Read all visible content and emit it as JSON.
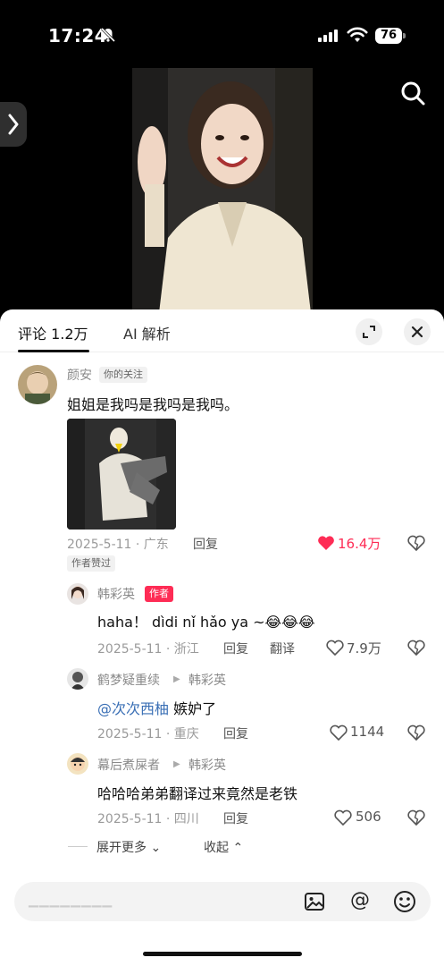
{
  "status_bar": {
    "time": "17:24",
    "battery": "76"
  },
  "tabs": {
    "comments": "评论 1.2万",
    "ai": "AI 解析"
  },
  "comments": [
    {
      "username": "颜安",
      "badge": "你的关注",
      "text": "姐姐是我吗是我吗是我吗。",
      "date_location": "2025-5-11 · 广东",
      "reply": "回复",
      "likes": "16.4万",
      "liked": true,
      "author_badge": "作者赞过"
    }
  ],
  "replies": [
    {
      "username": "韩彩英",
      "badge": "作者",
      "text": "haha！ dìdi nǐ hǎo ya ~",
      "date_location": "2025-5-11 · 浙江",
      "reply": "回复",
      "translate": "翻译",
      "likes": "7.9万"
    },
    {
      "username": "鹤梦疑重续",
      "reply_to": "韩彩英",
      "mention": "@次次西柚",
      "text": " 嫉妒了",
      "date_location": "2025-5-11 · 重庆",
      "reply": "回复",
      "likes": "1144"
    },
    {
      "username": "幕后煮屎者",
      "reply_to": "韩彩英",
      "text": "哈哈哈弟弟翻译过来竟然是老铁",
      "date_location": "2025-5-11 · 四川",
      "reply": "回复",
      "likes": "506"
    }
  ],
  "footer": {
    "expand_more": "展开更多",
    "collapse": "收起"
  },
  "colors": {
    "accent": "#fe2c55",
    "mention": "#3a6fb5"
  },
  "icons": [
    "bell-off-icon",
    "signal-icon",
    "wifi-icon",
    "battery-icon",
    "chevron-right-icon",
    "search-icon",
    "expand-icon",
    "close-icon",
    "heart-icon",
    "dislike-icon",
    "image-icon",
    "at-icon",
    "emoji-icon"
  ]
}
